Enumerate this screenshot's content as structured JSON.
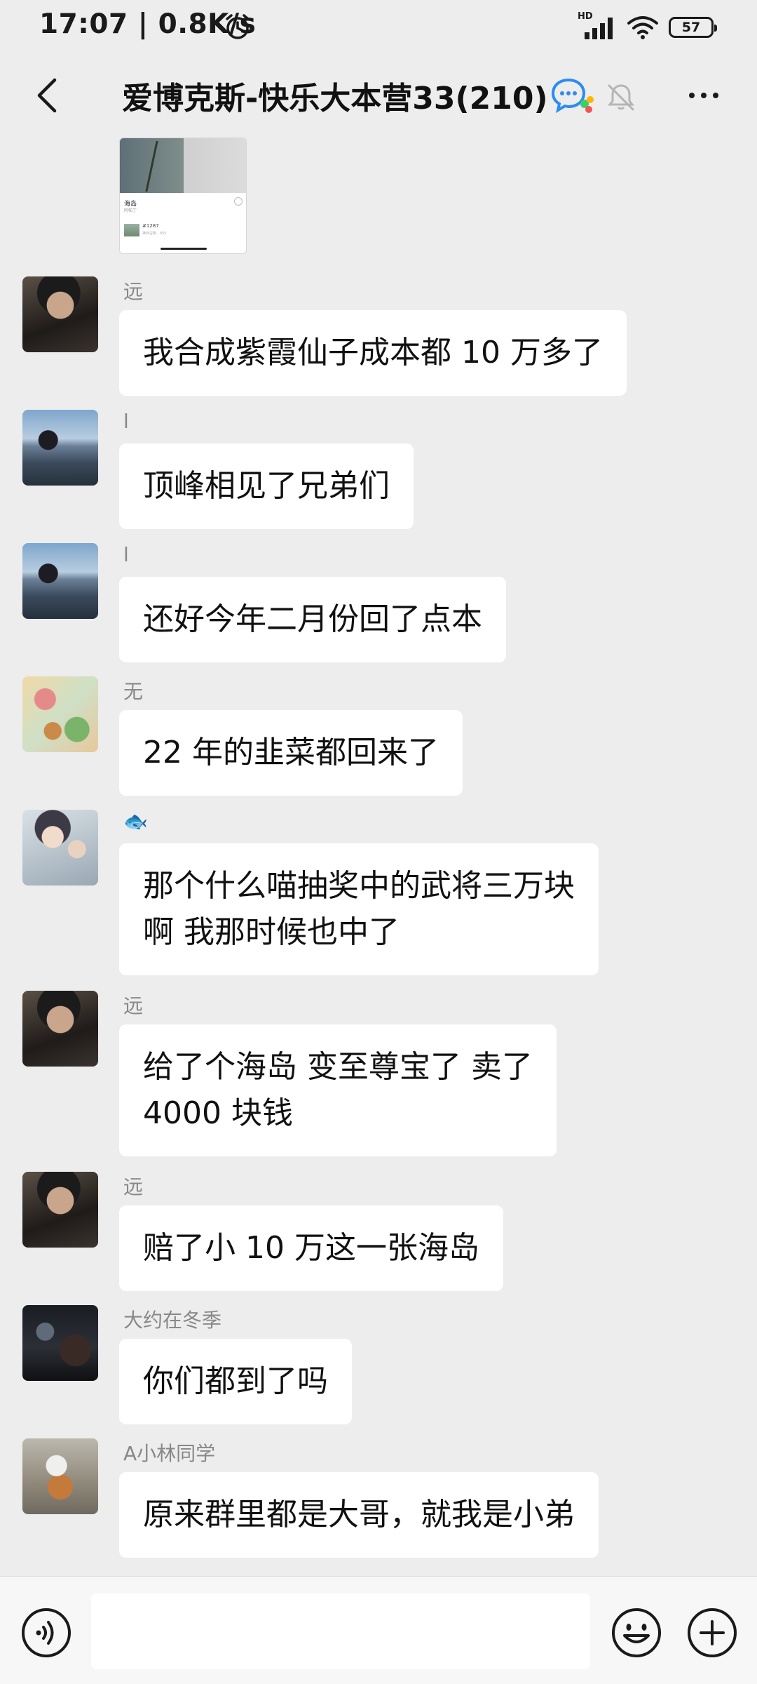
{
  "status_bar": {
    "time": "17:07",
    "net_speed": "0.8K/s",
    "network_badge": "HD",
    "battery": "57"
  },
  "header": {
    "title": "爱博克斯-快乐大本营33(210)"
  },
  "image_card": {
    "title": "海岛",
    "subtitle": "阿帕丁",
    "number": "#1287",
    "meta": "神兵宝物 · 955"
  },
  "messages": [
    {
      "sender": "远",
      "text": "我合成紫霞仙子成本都 10 万多了"
    },
    {
      "sender": "l",
      "text": "顶峰相见了兄弟们"
    },
    {
      "sender": "l",
      "text": "还好今年二月份回了点本"
    },
    {
      "sender": "无",
      "text": "22 年的韭菜都回来了"
    },
    {
      "sender": "🐟",
      "text_lines": [
        "那个什么喵抽奖中的武将三万块",
        "啊 我那时候也中了"
      ]
    },
    {
      "sender": "远",
      "text_lines": [
        "给了个海岛 变至尊宝了 卖了",
        "4000 块钱"
      ]
    },
    {
      "sender": "远",
      "text": "赔了小 10 万这一张海岛"
    },
    {
      "sender": "大约在冬季",
      "text": "你们都到了吗"
    },
    {
      "sender": "A小林同学",
      "text": "原来群里都是大哥，就我是小弟"
    }
  ],
  "input": {
    "value": "",
    "placeholder": ""
  },
  "icons": {
    "back": "back-arrow-icon",
    "group_badge": "qq-group-icon",
    "mute": "bell-muted-icon",
    "more": "more-dots-icon",
    "voice": "voice-icon",
    "emoji": "emoji-icon",
    "plus": "plus-icon"
  }
}
